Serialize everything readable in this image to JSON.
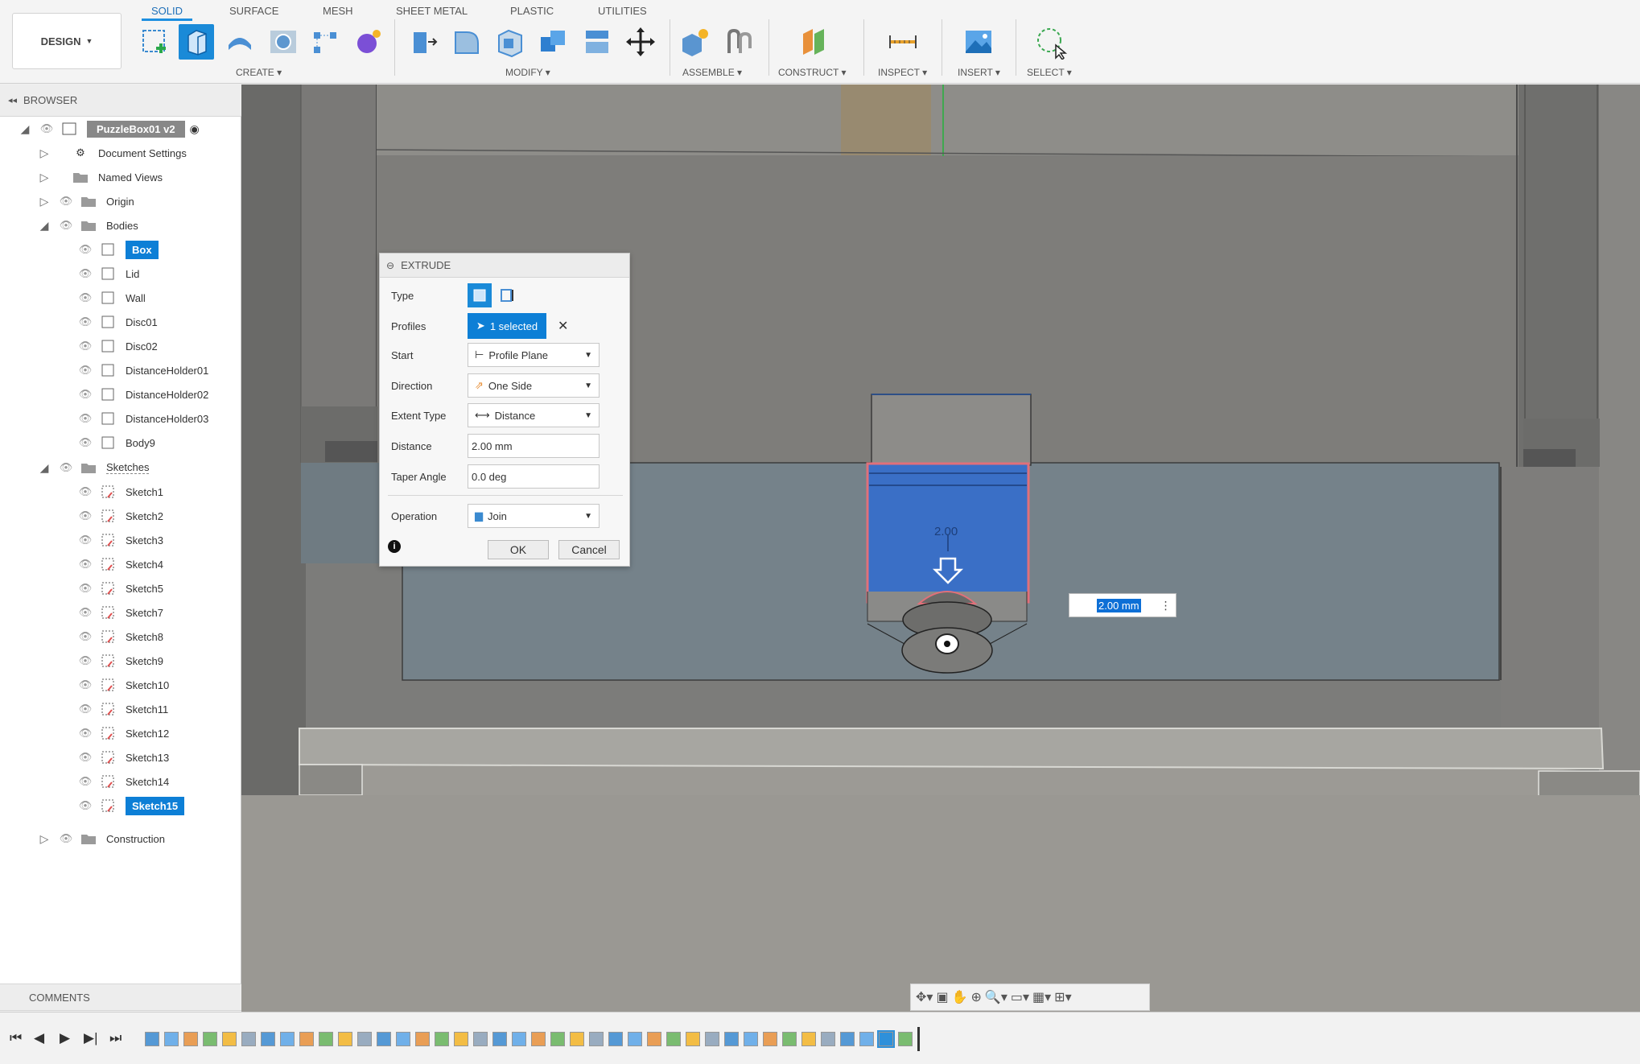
{
  "toolbar": {
    "workspace": "DESIGN",
    "tabs": [
      "SOLID",
      "SURFACE",
      "MESH",
      "SHEET METAL",
      "PLASTIC",
      "UTILITIES"
    ],
    "active_tab": "SOLID",
    "groups": {
      "create": "CREATE",
      "modify": "MODIFY",
      "assemble": "ASSEMBLE",
      "construct": "CONSTRUCT",
      "inspect": "INSPECT",
      "insert": "INSERT",
      "select": "SELECT"
    }
  },
  "browser": {
    "title": "BROWSER",
    "root": "PuzzleBox01 v2",
    "document_settings": "Document Settings",
    "named_views": "Named Views",
    "origin": "Origin",
    "bodies": {
      "label": "Bodies",
      "items": [
        "Box",
        "Lid",
        "Wall",
        "Disc01",
        "Disc02",
        "DistanceHolder01",
        "DistanceHolder02",
        "DistanceHolder03",
        "Body9"
      ],
      "selected": "Box"
    },
    "sketches": {
      "label": "Sketches",
      "items": [
        "Sketch1",
        "Sketch2",
        "Sketch3",
        "Sketch4",
        "Sketch5",
        "Sketch7",
        "Sketch8",
        "Sketch9",
        "Sketch10",
        "Sketch11",
        "Sketch12",
        "Sketch13",
        "Sketch14",
        "Sketch15"
      ],
      "selected": "Sketch15"
    },
    "construction": "Construction"
  },
  "comments": {
    "title": "COMMENTS"
  },
  "extrude": {
    "title": "EXTRUDE",
    "type_label": "Type",
    "profiles_label": "Profiles",
    "profiles_value": "1 selected",
    "start_label": "Start",
    "start_value": "Profile Plane",
    "direction_label": "Direction",
    "direction_value": "One Side",
    "extent_label": "Extent Type",
    "extent_value": "Distance",
    "distance_label": "Distance",
    "distance_value": "2.00 mm",
    "taper_label": "Taper Angle",
    "taper_value": "0.0 deg",
    "operation_label": "Operation",
    "operation_value": "Join",
    "ok": "OK",
    "cancel": "Cancel"
  },
  "viewport": {
    "inline_distance": "2.00 mm",
    "dimension_label": "2.00"
  },
  "colors": {
    "accent": "#0d7fd6",
    "profile_fill": "#3a6fc6",
    "profile_outline": "#e0707a",
    "viewport_bg": "#7a7a78"
  }
}
